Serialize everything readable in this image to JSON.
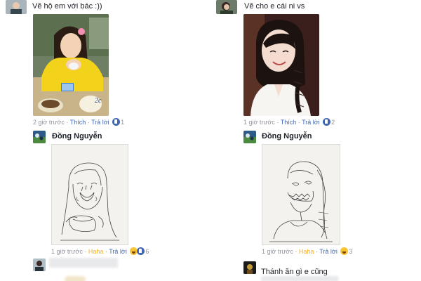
{
  "left_thread": {
    "comment_text": "Vẽ hộ em với bác :))",
    "photo_label": "2c",
    "meta": {
      "time": "2 giờ trước",
      "action": "Thích",
      "reply": "Trả lời",
      "reaction_icon": "like-icon",
      "reaction_count": "1"
    },
    "reply": {
      "username": "Đồng Nguyễn",
      "meta": {
        "time": "1 giờ trước",
        "action": "Haha",
        "reply": "Trả lời",
        "reaction_icon": "like-haha-icon",
        "reaction_count": "6"
      }
    }
  },
  "right_thread": {
    "comment_text": "Vẽ cho e cái ni vs",
    "meta": {
      "time": "1 giờ trước",
      "action": "Thích",
      "reply": "Trả lời",
      "reaction_icon": "like-icon",
      "reaction_count": "2"
    },
    "reply": {
      "username": "Đồng Nguyễn",
      "meta": {
        "time": "1 giờ trước",
        "action": "Haha",
        "reply": "Trả lời",
        "reaction_icon": "haha-icon",
        "reaction_count": "3"
      }
    },
    "next_comment_text": "Thánh ăn gì e cũng"
  },
  "colors": {
    "link_blue": "#4267b2",
    "meta_gray": "#90949c",
    "haha_yellow": "#f7b125",
    "text_dark": "#1d2129"
  }
}
